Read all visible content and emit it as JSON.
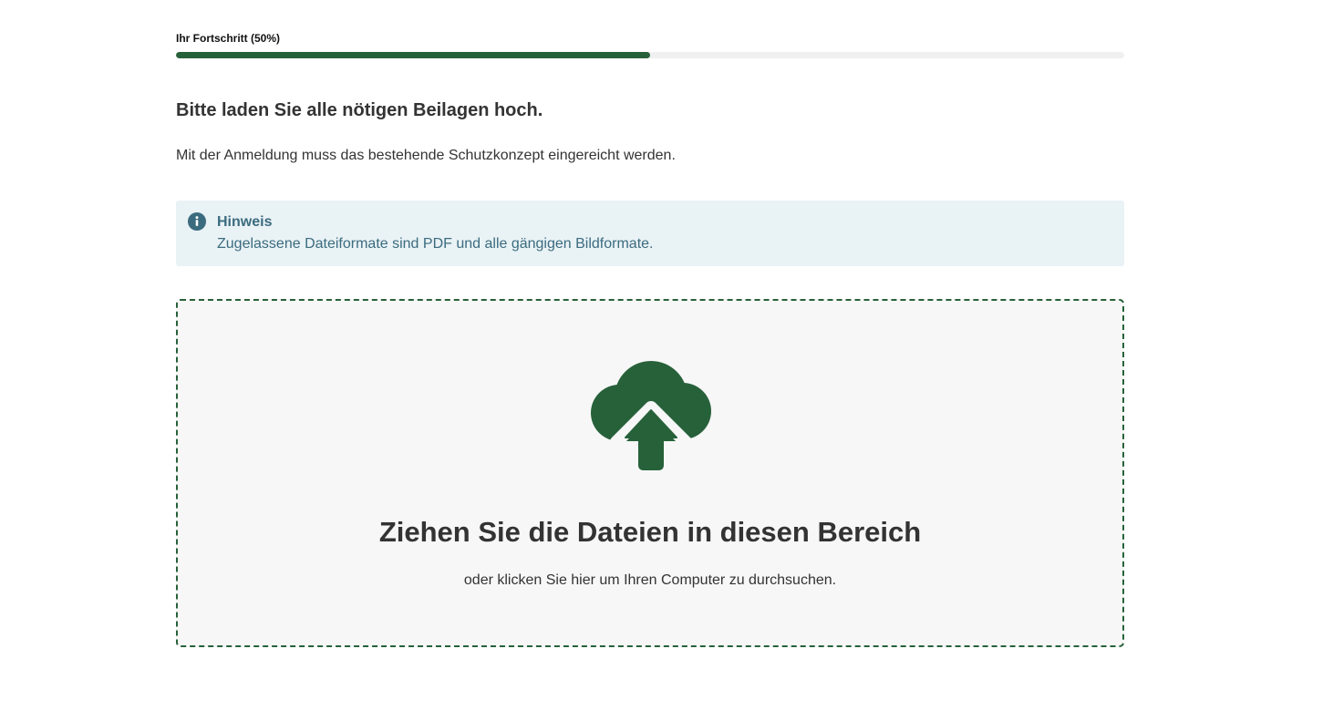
{
  "progress": {
    "label": "Ihr Fortschritt (50%)",
    "value": 0.5,
    "fill_color": "#27613a",
    "track_color": "#f0f0f0"
  },
  "main": {
    "heading": "Bitte laden Sie alle nötigen Beilagen hoch.",
    "lead": "Mit der Anmeldung muss das bestehende Schutzkonzept eingereicht werden."
  },
  "notice": {
    "icon": "info-icon",
    "title": "Hinweis",
    "text": "Zugelassene Dateiformate sind PDF und alle gängigen Bildformate.",
    "background_color": "#e9f2f5",
    "text_color": "#3b6b7f"
  },
  "dropzone": {
    "icon": "cloud-upload-icon",
    "title": "Ziehen Sie die Dateien in diesen Bereich",
    "subtitle": "oder klicken Sie hier um Ihren Computer zu durchsuchen.",
    "accent_color": "#27613a"
  }
}
